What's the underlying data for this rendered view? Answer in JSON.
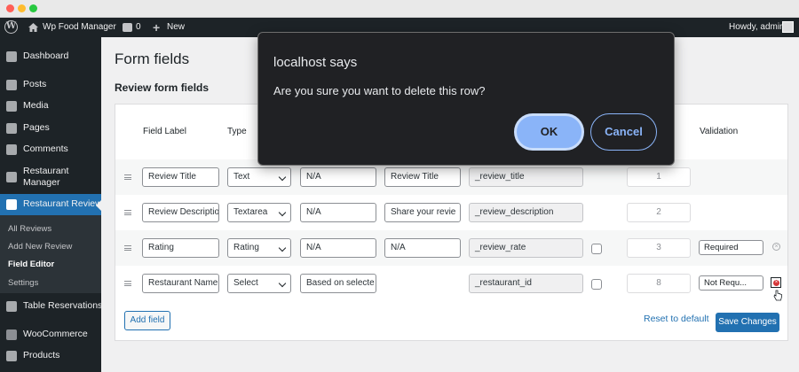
{
  "admin_bar": {
    "site_name": "Wp Food Manager",
    "comments_count": "0",
    "new_label": "New",
    "howdy": "Howdy, admin"
  },
  "sidebar": {
    "items": [
      {
        "label": "Dashboard",
        "icon": "dashboard-icon"
      },
      {
        "label": "Posts",
        "icon": "pin-icon"
      },
      {
        "label": "Media",
        "icon": "media-icon"
      },
      {
        "label": "Pages",
        "icon": "pages-icon"
      },
      {
        "label": "Comments",
        "icon": "comments-icon"
      },
      {
        "label": "Restaurant Manager",
        "icon": "restaurant-icon"
      },
      {
        "label": "Restaurant Review",
        "icon": "star-icon"
      },
      {
        "label": "Table Reservations",
        "icon": "table-icon"
      },
      {
        "label": "WooCommerce",
        "icon": "woo-icon"
      },
      {
        "label": "Products",
        "icon": "products-icon"
      }
    ],
    "submenu": [
      "All Reviews",
      "Add New Review",
      "Field Editor",
      "Settings"
    ]
  },
  "page": {
    "title": "Form fields",
    "section_title": "Review form fields"
  },
  "table": {
    "headers": {
      "field_label": "Field Label",
      "type": "Type",
      "validation": "Validation"
    },
    "rows": [
      {
        "label": "Review Title",
        "type": "Text",
        "placeholder": "N/A",
        "description": "Review Title",
        "meta_key": "_review_title",
        "priority": "1",
        "validation": ""
      },
      {
        "label": "Review Descriptio",
        "type": "Textarea",
        "placeholder": "N/A",
        "description": "Share your revie",
        "meta_key": "_review_description",
        "priority": "2",
        "validation": ""
      },
      {
        "label": "Rating",
        "type": "Rating",
        "placeholder": "N/A",
        "description": "N/A",
        "meta_key": "_review_rate",
        "priority": "3",
        "validation": "Required"
      },
      {
        "label": "Restaurant Name",
        "type": "Select",
        "placeholder": "Based on selecte",
        "description": "",
        "meta_key": "_restaurant_id",
        "priority": "8",
        "validation": "Not Requ..."
      }
    ]
  },
  "actions": {
    "add_field": "Add field",
    "reset": "Reset to default",
    "save": "Save Changes"
  },
  "dialog": {
    "title": "localhost says",
    "message": "Are you sure you want to delete this row?",
    "ok": "OK",
    "cancel": "Cancel"
  }
}
